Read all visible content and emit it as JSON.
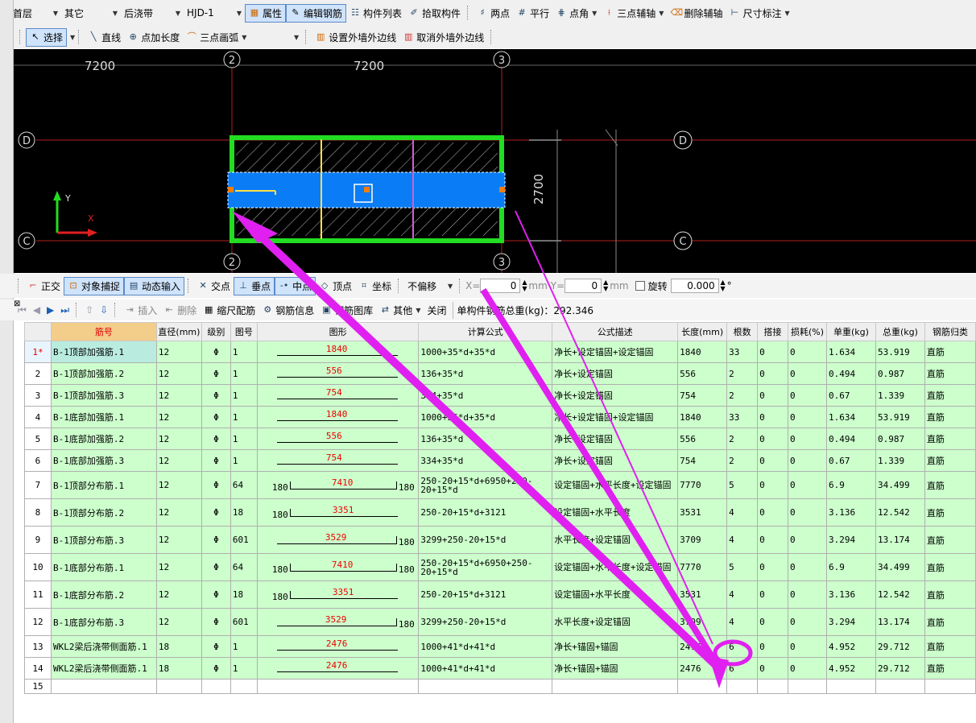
{
  "toolbar1": {
    "floor": "首层",
    "category": "其它",
    "type": "后浇带",
    "element": "HJD-1",
    "properties": "属性",
    "edit_rebar": "编辑钢筋",
    "component_list": "构件列表",
    "pick_component": "拾取构件",
    "two_point": "两点",
    "parallel": "平行",
    "point_angle": "点角",
    "three_point_axis": "三点辅轴",
    "delete_axis": "删除辅轴",
    "dimension": "尺寸标注"
  },
  "toolbar2": {
    "select": "选择",
    "line": "直线",
    "point_length": "点加长度",
    "three_point_arc": "三点画弧",
    "set_outer_wall": "设置外墙外边线",
    "cancel_outer_wall": "取消外墙外边线"
  },
  "canvas": {
    "dim_left": "7200",
    "dim_mid": "7200",
    "dim_right": "2700",
    "axis_2": "2",
    "axis_3": "3",
    "axis_D": "D",
    "axis_C": "C",
    "axis_y": "Y",
    "axis_x": "X"
  },
  "snapbar": {
    "ortho": "正交",
    "object_snap": "对象捕捉",
    "dynamic_input": "动态输入",
    "intersection": "交点",
    "perpendicular": "垂点",
    "midpoint": "中点",
    "vertex": "顶点",
    "coordinate": "坐标",
    "offset": "不偏移",
    "x_label": "X=",
    "x_value": "0",
    "y_label": "Y=",
    "y_value": "0",
    "unit": "mm",
    "rotate": "旋转",
    "rotate_value": "0.000",
    "deg": "°"
  },
  "tabletoolbar": {
    "insert": "插入",
    "delete": "删除",
    "ruler": "缩尺配筋",
    "rebar_info": "钢筋信息",
    "rebar_library": "钢筋图库",
    "other": "其他",
    "close": "关闭",
    "total_weight": "单构件钢筋总重(kg)：292.346"
  },
  "table": {
    "headers": [
      "筋号",
      "直径(mm)",
      "级别",
      "图号",
      "图形",
      "计算公式",
      "公式描述",
      "长度(mm)",
      "根数",
      "搭接",
      "损耗(%)",
      "单重(kg)",
      "总重(kg)",
      "钢筋归类"
    ],
    "rows": [
      {
        "n": "1*",
        "name": "B-1顶部加强筋.1",
        "d": "12",
        "grade": "Φ",
        "fig": "1",
        "shape": {
          "val": "1840"
        },
        "formula": "1000+35*d+35*d",
        "desc": "净长+设定锚固+设定锚固",
        "len": "1840",
        "count": "33",
        "lap": "0",
        "loss": "0",
        "unit": "1.634",
        "total": "53.919",
        "cls": "直筋"
      },
      {
        "n": "2",
        "name": "B-1顶部加强筋.2",
        "d": "12",
        "grade": "Φ",
        "fig": "1",
        "shape": {
          "val": "556"
        },
        "formula": "136+35*d",
        "desc": "净长+设定锚固",
        "len": "556",
        "count": "2",
        "lap": "0",
        "loss": "0",
        "unit": "0.494",
        "total": "0.987",
        "cls": "直筋"
      },
      {
        "n": "3",
        "name": "B-1顶部加强筋.3",
        "d": "12",
        "grade": "Φ",
        "fig": "1",
        "shape": {
          "val": "754"
        },
        "formula": "334+35*d",
        "desc": "净长+设定锚固",
        "len": "754",
        "count": "2",
        "lap": "0",
        "loss": "0",
        "unit": "0.67",
        "total": "1.339",
        "cls": "直筋"
      },
      {
        "n": "4",
        "name": "B-1底部加强筋.1",
        "d": "12",
        "grade": "Φ",
        "fig": "1",
        "shape": {
          "val": "1840"
        },
        "formula": "1000+35*d+35*d",
        "desc": "净长+设定锚固+设定锚固",
        "len": "1840",
        "count": "33",
        "lap": "0",
        "loss": "0",
        "unit": "1.634",
        "total": "53.919",
        "cls": "直筋"
      },
      {
        "n": "5",
        "name": "B-1底部加强筋.2",
        "d": "12",
        "grade": "Φ",
        "fig": "1",
        "shape": {
          "val": "556"
        },
        "formula": "136+35*d",
        "desc": "净长+设定锚固",
        "len": "556",
        "count": "2",
        "lap": "0",
        "loss": "0",
        "unit": "0.494",
        "total": "0.987",
        "cls": "直筋"
      },
      {
        "n": "6",
        "name": "B-1底部加强筋.3",
        "d": "12",
        "grade": "Φ",
        "fig": "1",
        "shape": {
          "val": "754"
        },
        "formula": "334+35*d",
        "desc": "净长+设定锚固",
        "len": "754",
        "count": "2",
        "lap": "0",
        "loss": "0",
        "unit": "0.67",
        "total": "1.339",
        "cls": "直筋"
      },
      {
        "n": "7",
        "name": "B-1顶部分布筋.1",
        "d": "12",
        "grade": "Φ",
        "fig": "64",
        "shape": {
          "val": "7410",
          "left": "180",
          "right": "180"
        },
        "formula": "250-20+15*d+6950+250-20+15*d",
        "desc": "设定锚固+水平长度+设定锚固",
        "len": "7770",
        "count": "5",
        "lap": "0",
        "loss": "0",
        "unit": "6.9",
        "total": "34.499",
        "cls": "直筋"
      },
      {
        "n": "8",
        "name": "B-1顶部分布筋.2",
        "d": "12",
        "grade": "Φ",
        "fig": "18",
        "shape": {
          "val": "3351",
          "left": "180"
        },
        "formula": "250-20+15*d+3121",
        "desc": "设定锚固+水平长度",
        "len": "3531",
        "count": "4",
        "lap": "0",
        "loss": "0",
        "unit": "3.136",
        "total": "12.542",
        "cls": "直筋"
      },
      {
        "n": "9",
        "name": "B-1顶部分布筋.3",
        "d": "12",
        "grade": "Φ",
        "fig": "601",
        "shape": {
          "val": "3529",
          "right": "180"
        },
        "formula": "3299+250-20+15*d",
        "desc": "水平长度+设定锚固",
        "len": "3709",
        "count": "4",
        "lap": "0",
        "loss": "0",
        "unit": "3.294",
        "total": "13.174",
        "cls": "直筋"
      },
      {
        "n": "10",
        "name": "B-1底部分布筋.1",
        "d": "12",
        "grade": "Φ",
        "fig": "64",
        "shape": {
          "val": "7410",
          "left": "180",
          "right": "180"
        },
        "formula": "250-20+15*d+6950+250-20+15*d",
        "desc": "设定锚固+水平长度+设定锚固",
        "len": "7770",
        "count": "5",
        "lap": "0",
        "loss": "0",
        "unit": "6.9",
        "total": "34.499",
        "cls": "直筋"
      },
      {
        "n": "11",
        "name": "B-1底部分布筋.2",
        "d": "12",
        "grade": "Φ",
        "fig": "18",
        "shape": {
          "val": "3351",
          "left": "180"
        },
        "formula": "250-20+15*d+3121",
        "desc": "设定锚固+水平长度",
        "len": "3531",
        "count": "4",
        "lap": "0",
        "loss": "0",
        "unit": "3.136",
        "total": "12.542",
        "cls": "直筋"
      },
      {
        "n": "12",
        "name": "B-1底部分布筋.3",
        "d": "12",
        "grade": "Φ",
        "fig": "601",
        "shape": {
          "val": "3529",
          "right": "180"
        },
        "formula": "3299+250-20+15*d",
        "desc": "水平长度+设定锚固",
        "len": "3709",
        "count": "4",
        "lap": "0",
        "loss": "0",
        "unit": "3.294",
        "total": "13.174",
        "cls": "直筋"
      },
      {
        "n": "13",
        "name": "WKL2梁后浇带侧面筋.1",
        "d": "18",
        "grade": "Φ",
        "fig": "1",
        "shape": {
          "val": "2476"
        },
        "formula": "1000+41*d+41*d",
        "desc": "净长+锚固+锚固",
        "len": "2476",
        "count": "6",
        "lap": "0",
        "loss": "0",
        "unit": "4.952",
        "total": "29.712",
        "cls": "直筋"
      },
      {
        "n": "14",
        "name": "WKL2梁后浇带侧面筋.1",
        "d": "18",
        "grade": "Φ",
        "fig": "1",
        "shape": {
          "val": "2476"
        },
        "formula": "1000+41*d+41*d",
        "desc": "净长+锚固+锚固",
        "len": "2476",
        "count": "6",
        "lap": "0",
        "loss": "0",
        "unit": "4.952",
        "total": "29.712",
        "cls": "直筋"
      }
    ],
    "empty_row": "15"
  },
  "colors": {
    "accent_arrow": "#e020f0",
    "slab_blue": "#0a7cf5",
    "green_border": "#22dd22",
    "row_green": "#ccffcc"
  }
}
